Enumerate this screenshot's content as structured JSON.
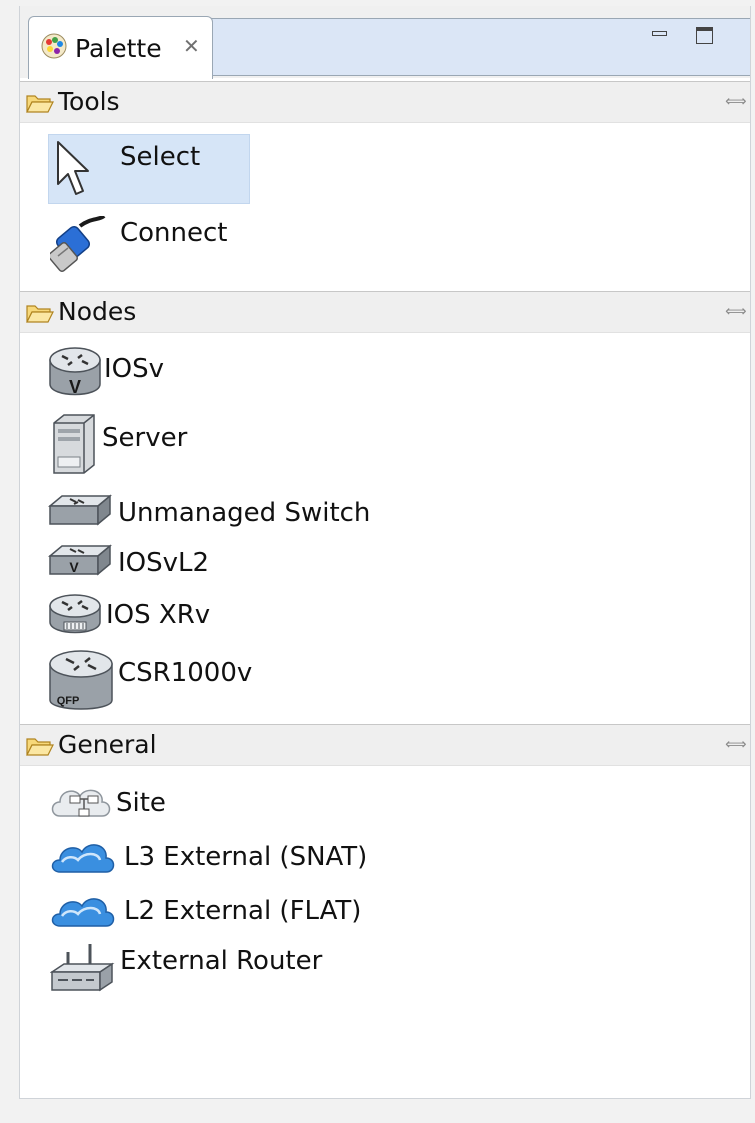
{
  "tab": {
    "label": "Palette"
  },
  "drawers": {
    "tools": {
      "title": "Tools",
      "items": [
        {
          "label": "Select",
          "icon": "arrow-pointer-icon"
        },
        {
          "label": "Connect",
          "icon": "cable-connector-icon"
        }
      ]
    },
    "nodes": {
      "title": "Nodes",
      "items": [
        {
          "label": "IOSv",
          "icon": "router-icon"
        },
        {
          "label": "Server",
          "icon": "server-icon"
        },
        {
          "label": "Unmanaged Switch",
          "icon": "switch-icon"
        },
        {
          "label": "IOSvL2",
          "icon": "l2-switch-icon"
        },
        {
          "label": "IOS XRv",
          "icon": "xr-router-icon"
        },
        {
          "label": "CSR1000v",
          "icon": "csr-router-icon"
        }
      ]
    },
    "general": {
      "title": "General",
      "items": [
        {
          "label": "Site",
          "icon": "site-cloud-icon"
        },
        {
          "label": "L3 External (SNAT)",
          "icon": "cloud-icon"
        },
        {
          "label": "L2 External (FLAT)",
          "icon": "cloud-icon"
        },
        {
          "label": "External Router",
          "icon": "external-router-icon"
        }
      ]
    }
  },
  "colors": {
    "tab_strip": "#dbe6f6",
    "selection": "#d6e5f7",
    "header": "#efefef"
  }
}
